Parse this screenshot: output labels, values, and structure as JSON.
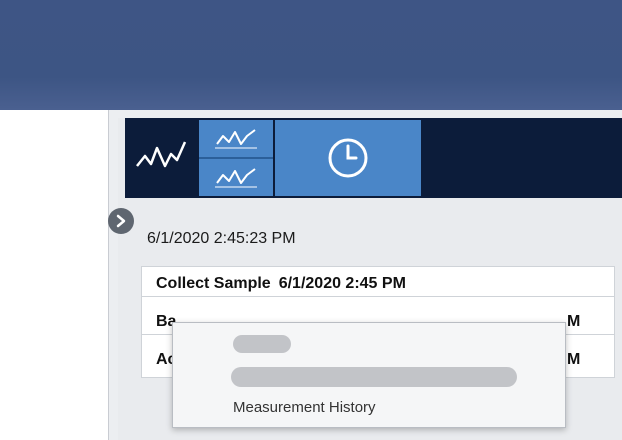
{
  "window": {
    "colors": {
      "topbar": "#3d5584",
      "toolbar": "#0c1c3a",
      "toolbar_button": "#4a86c8"
    }
  },
  "toolbar": {
    "buttons": [
      {
        "name": "trend-view",
        "icon": "line-chart-icon"
      },
      {
        "name": "split-trend-view",
        "icon": "line-chart-icon"
      },
      {
        "name": "history",
        "icon": "clock-icon"
      }
    ]
  },
  "panel": {
    "expand_icon": "chevron-right-icon",
    "timestamp": "6/1/2020 2:45:23 PM"
  },
  "events": [
    {
      "label": "Collect Sample",
      "time": "6/1/2020 2:45 PM"
    },
    {
      "label": "Ba",
      "time": "M",
      "partially_obscured": true
    },
    {
      "label": "Ac",
      "time": "M",
      "partially_obscured": true
    }
  ],
  "popup": {
    "item_label": "Measurement History"
  }
}
